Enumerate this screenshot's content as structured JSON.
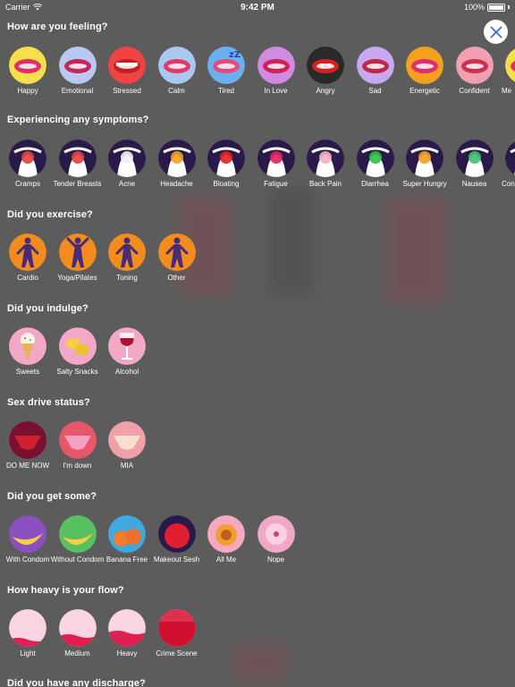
{
  "status": {
    "carrier": "Carrier",
    "time": "9:42 PM",
    "battery": "100%"
  },
  "close_icon": "close-x-icon",
  "sections": {
    "feeling": {
      "title": "How are you feeling?",
      "items": [
        "Happy",
        "Emotional",
        "Stressed",
        "Calm",
        "Tired",
        "In Love",
        "Angry",
        "Sad",
        "Energetic",
        "Confident",
        "Me"
      ]
    },
    "symptoms": {
      "title": "Experiencing any symptoms?",
      "items": [
        "Cramps",
        "Tender Breasts",
        "Acne",
        "Headache",
        "Bloating",
        "Fatigue",
        "Back Pain",
        "Diarrhea",
        "Super Hungry",
        "Nausea",
        "Con"
      ]
    },
    "exercise": {
      "title": "Did you exercise?",
      "items": [
        "Cardio",
        "Yoga/Pilates",
        "Toning",
        "Other"
      ]
    },
    "indulge": {
      "title": "Did you indulge?",
      "items": [
        "Sweets",
        "Salty Snacks",
        "Alcohol"
      ]
    },
    "sexdrive": {
      "title": "Sex drive status?",
      "items": [
        "DO ME NOW",
        "I'm down",
        "MIA"
      ]
    },
    "getsome": {
      "title": "Did you get some?",
      "items": [
        "With Condom",
        "Without Condom",
        "Banana Free",
        "Makeout Sesh",
        "All Me",
        "Nope"
      ]
    },
    "flow": {
      "title": "How heavy is your flow?",
      "items": [
        "Light",
        "Medium",
        "Heavy",
        "Crime Scene"
      ]
    },
    "discharge": {
      "title": "Did you have any discharge?"
    }
  },
  "colors": {
    "feeling": "#e8e0f0",
    "symptoms": "#2a1a4a",
    "exercise": "#f28c1c",
    "indulge": "#f4a8c8",
    "sexdrive": "#e8566a",
    "getsome": "#d25ea8",
    "flow": "#f7b6cc"
  }
}
